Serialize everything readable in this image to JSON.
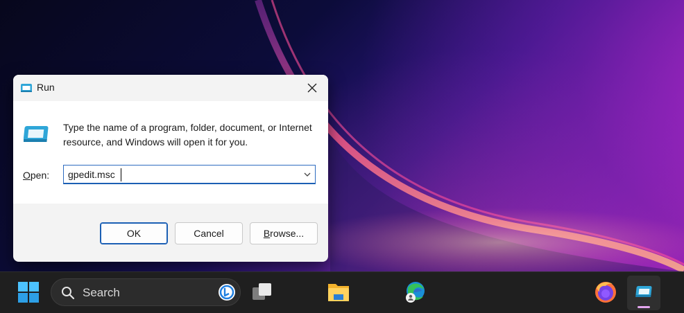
{
  "dialog": {
    "title": "Run",
    "description": "Type the name of a program, folder, document, or Internet resource, and Windows will open it for you.",
    "open_label_accel": "O",
    "open_label_rest": "pen:",
    "open_value": "gpedit.msc",
    "ok_label": "OK",
    "cancel_label": "Cancel",
    "browse_label_accel": "B",
    "browse_label_rest": "rowse..."
  },
  "taskbar": {
    "search_placeholder": "Search",
    "indicator_color": "#e3a5ee"
  },
  "icons": {
    "title": "run-icon",
    "close": "close-icon",
    "dropdown": "chevron-down-icon",
    "start": "windows-start-icon",
    "search": "search-icon",
    "bing": "bing-icon",
    "taskview": "task-view-icon",
    "explorer": "file-explorer-icon",
    "edge": "edge-browser-icon",
    "firefox": "firefox-icon",
    "run": "run-icon"
  }
}
